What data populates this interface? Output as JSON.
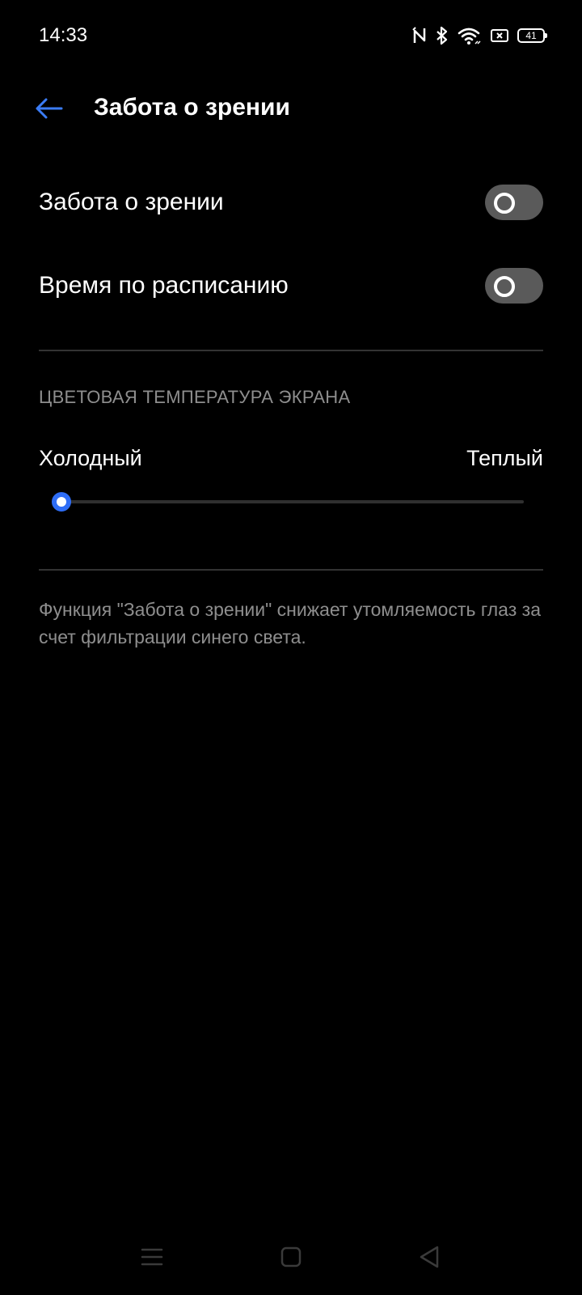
{
  "status_bar": {
    "time": "14:33",
    "battery_level": "41",
    "icons": [
      "nfc-icon",
      "bluetooth-icon",
      "wifi-icon",
      "sim-off-icon",
      "battery-icon"
    ]
  },
  "header": {
    "title": "Забота о зрении",
    "back_icon": "arrow-left-icon"
  },
  "settings": {
    "eye_care": {
      "label": "Забота о зрении",
      "enabled": false
    },
    "schedule": {
      "label": "Время по расписанию",
      "enabled": false
    }
  },
  "color_temperature": {
    "section_title": "ЦВЕТОВАЯ ТЕМПЕРАТУРА ЭКРАНА",
    "min_label": "Холодный",
    "max_label": "Теплый",
    "value": 0
  },
  "description": "Функция \"Забота о зрении\" снижает утомляемость глаз за счет фильтрации синего света.",
  "colors": {
    "background": "#000000",
    "accent": "#2e6df6",
    "toggle_off": "#5a5a5a",
    "secondary_text": "#8e8e8e"
  },
  "nav_bar": {
    "icons": [
      "menu-icon",
      "home-icon",
      "back-icon"
    ]
  }
}
